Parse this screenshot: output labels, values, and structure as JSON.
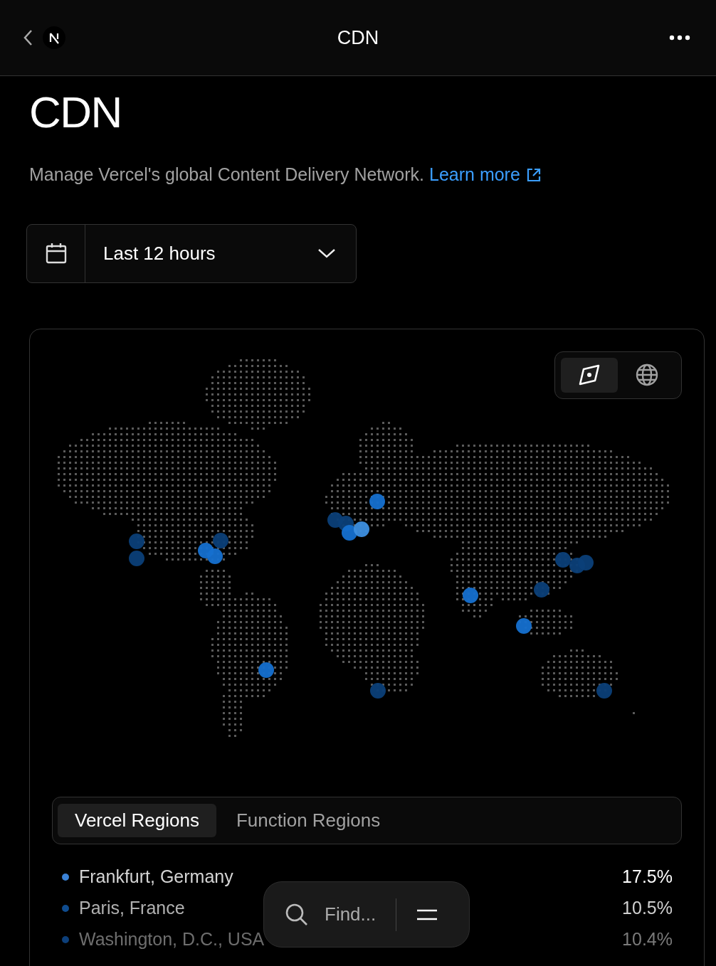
{
  "header": {
    "title": "CDN"
  },
  "page": {
    "heading": "CDN",
    "description": "Manage Vercel's global Content Delivery Network.",
    "link": "Learn more"
  },
  "time_range": {
    "value": "Last 12 hours"
  },
  "map_views": [
    {
      "kind": "flat",
      "selected": true
    },
    {
      "kind": "globe",
      "selected": false
    }
  ],
  "tabs": [
    {
      "label": "Vercel Regions",
      "selected": true
    },
    {
      "label": "Function Regions",
      "selected": false
    }
  ],
  "regions": [
    {
      "name": "Frankfurt, Germany",
      "share": "17.5%",
      "color": "#3b82d6"
    },
    {
      "name": "Paris, France",
      "share": "10.5%",
      "color": "#0f4c8f"
    },
    {
      "name": "Washington, D.C., USA",
      "share": "10.4%",
      "color": "#0d3f7a"
    }
  ],
  "find_bar": {
    "placeholder": "Find..."
  }
}
